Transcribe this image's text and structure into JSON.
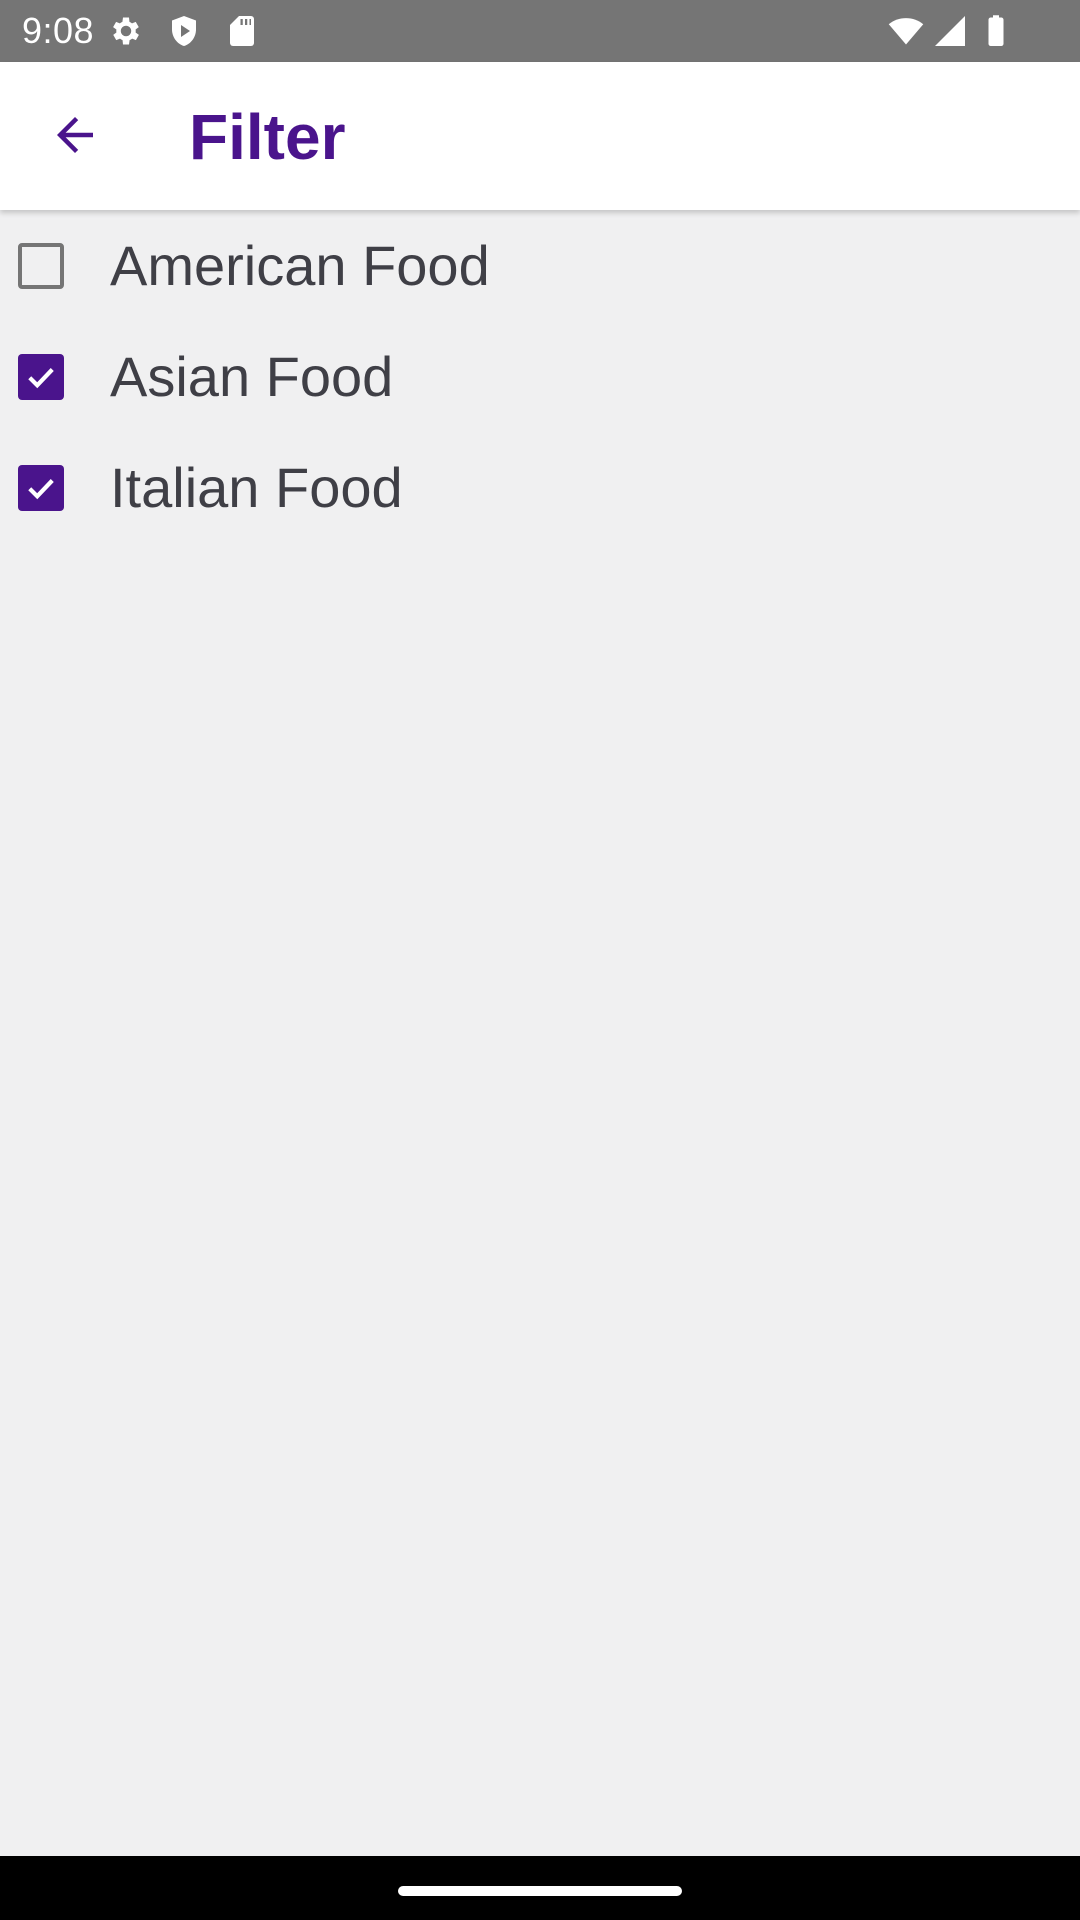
{
  "status_bar": {
    "time": "9:08",
    "left_icons": [
      "gear-icon",
      "shield-play-icon",
      "sd-card-icon"
    ],
    "right_icons": [
      "wifi-icon",
      "cellular-signal-icon",
      "battery-icon"
    ]
  },
  "app_bar": {
    "back_icon": "arrow-back-icon",
    "title": "Filter"
  },
  "filters": [
    {
      "label": "American Food",
      "checked": false
    },
    {
      "label": "Asian Food",
      "checked": true
    },
    {
      "label": "Italian Food",
      "checked": true
    }
  ],
  "colors": {
    "accent": "#4a148c",
    "status_bar": "#757575",
    "background": "#f0f0f1",
    "text": "#3f3f46"
  }
}
